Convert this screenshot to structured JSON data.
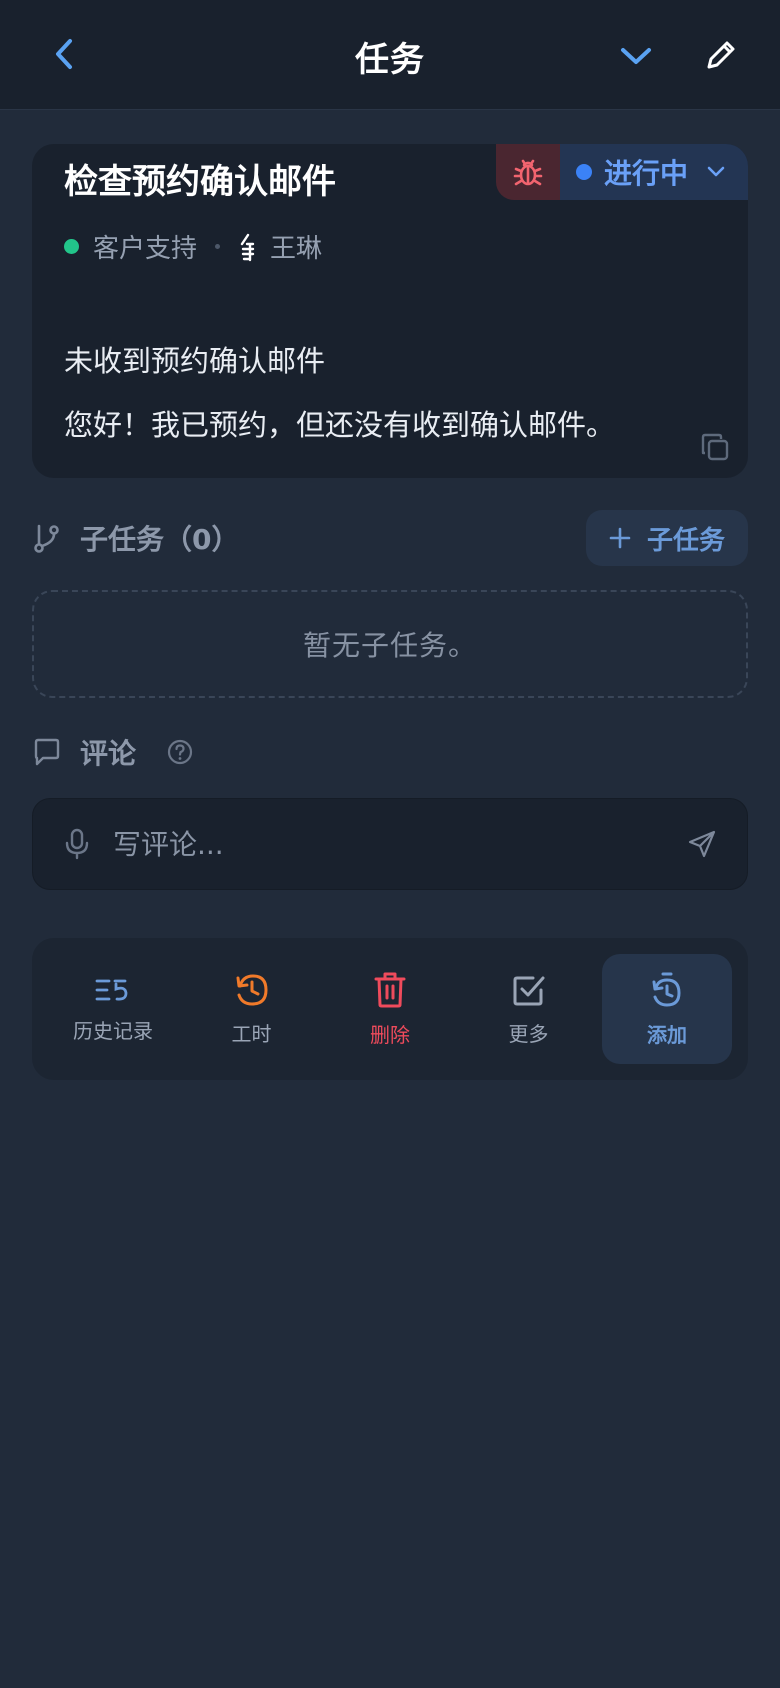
{
  "header": {
    "title": "任务"
  },
  "task": {
    "title": "检查预约确认邮件",
    "status": "进行中",
    "category": "客户支持",
    "assignee": "王琳",
    "description_title": "未收到预约确认邮件",
    "description_body": "您好！我已预约，但还没有收到确认邮件。"
  },
  "subtasks": {
    "heading": "子任务（0）",
    "add_label": "子任务",
    "empty_text": "暂无子任务。"
  },
  "comments": {
    "heading": "评论",
    "placeholder": "写评论..."
  },
  "actions": {
    "history": "历史记录",
    "hours": "工时",
    "delete": "删除",
    "more": "更多",
    "add": "添加"
  },
  "colors": {
    "accent": "#6aa0f7",
    "status_dot": "#3b82f6",
    "category_dot": "#22c58a",
    "danger": "#ef4b5c",
    "hours_icon": "#f07a2a"
  },
  "icons": [
    "back-icon",
    "chevron-down-icon",
    "pencil-icon",
    "bug-icon",
    "avatar-icon",
    "copy-icon",
    "branch-icon",
    "plus-icon",
    "comment-icon",
    "help-icon",
    "microphone-icon",
    "send-icon",
    "history-list-icon",
    "clock-history-icon",
    "trash-icon",
    "checkbox-icon",
    "timer-icon"
  ]
}
